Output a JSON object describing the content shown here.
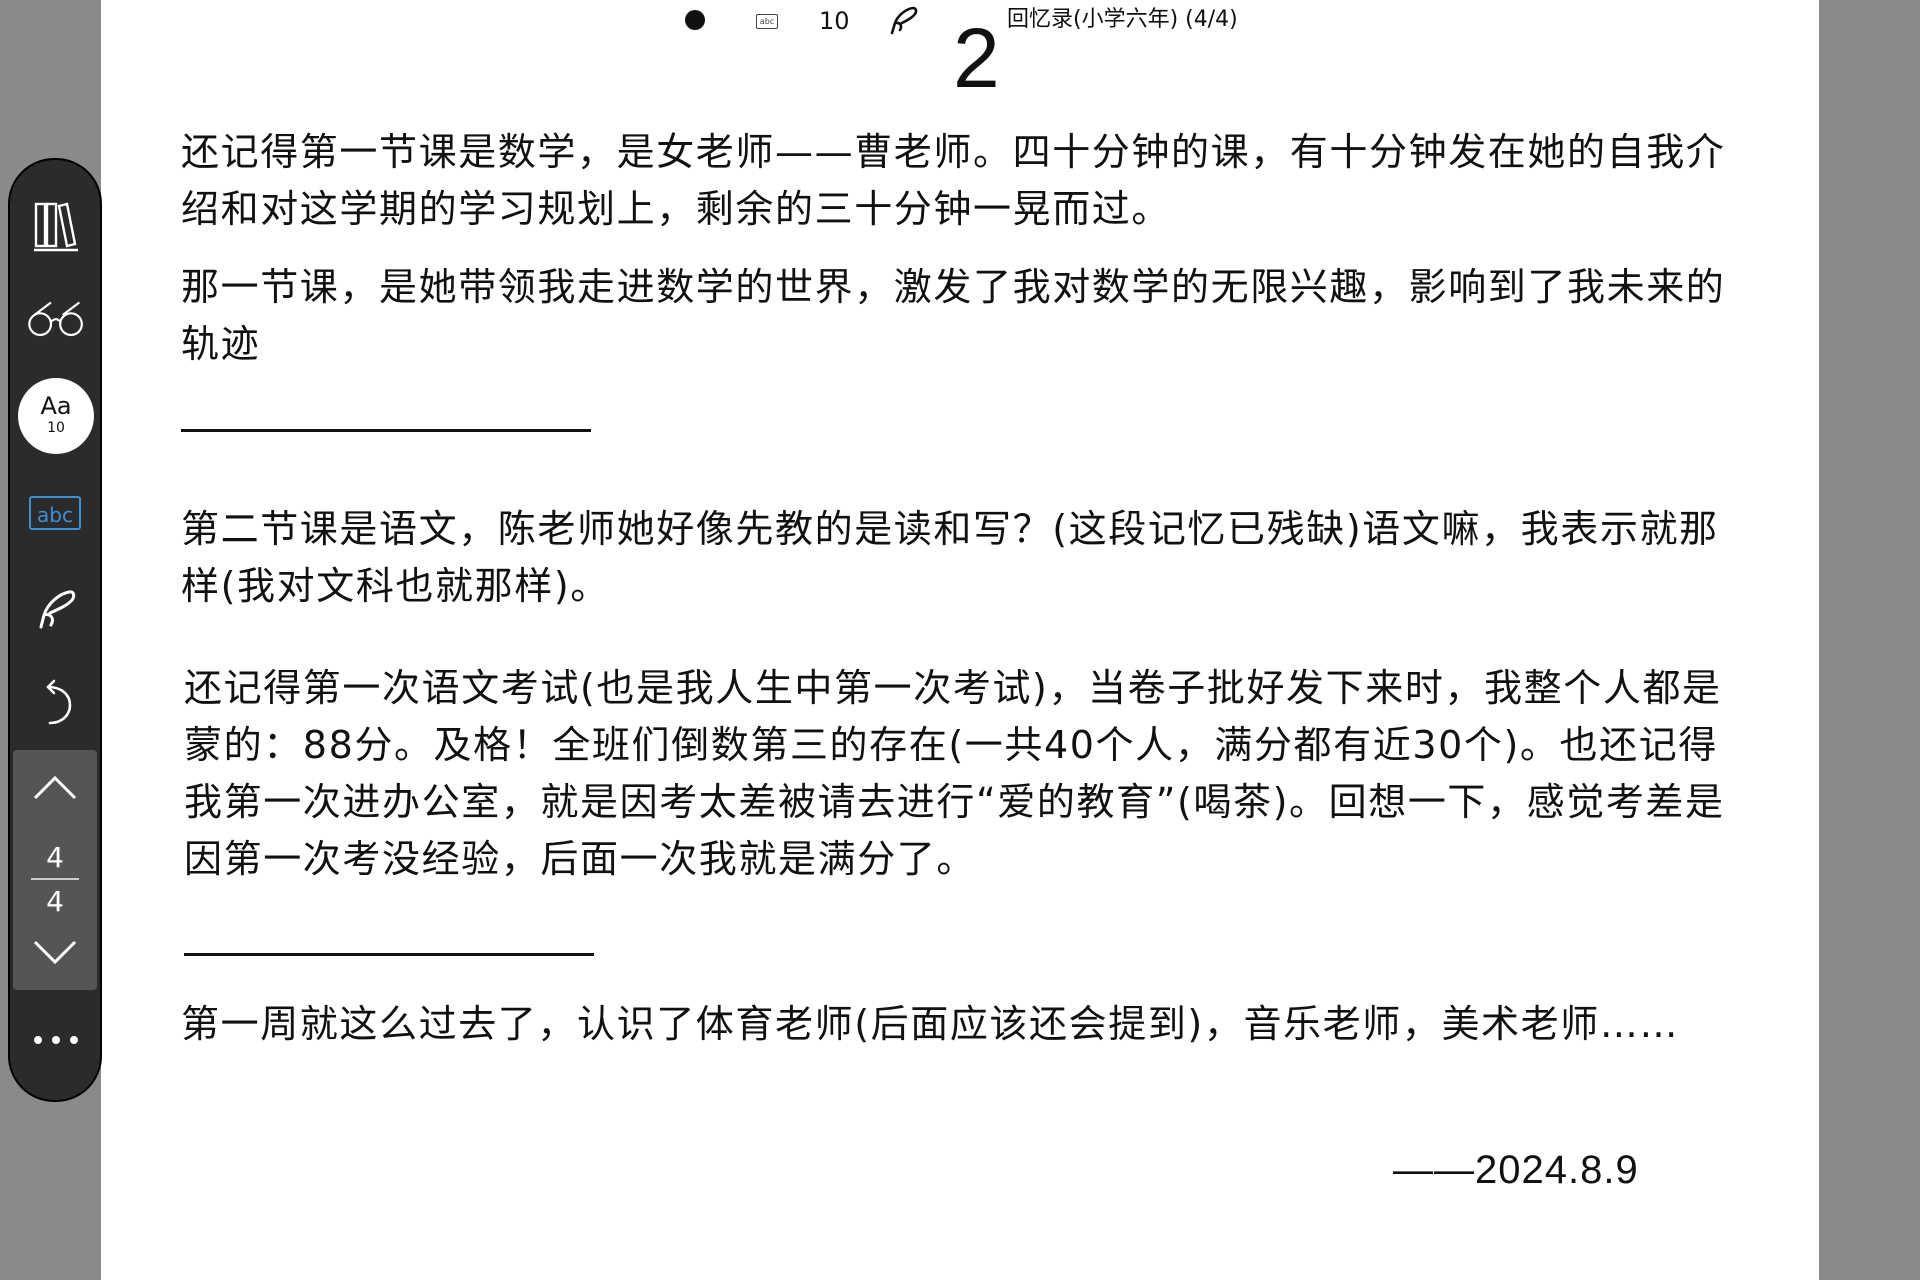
{
  "status_bar": {
    "font_size": "10",
    "book_title": "回忆录(小学六年) (4/4)"
  },
  "page_number": "2",
  "paragraphs": [
    [
      "还记得第一节课是数学，是女老师——曹老师。四十分钟的课，有十分钟发在她的自我介",
      "绍和对这学期的学习规划上，剩余的三十分钟一晃而过。"
    ],
    [
      "那一节课，是她带领我走进数学的世界，激发了我对数学的无限兴趣，影响到了我未来的",
      "轨迹"
    ],
    [
      "第二节课是语文，陈老师她好像先教的是读和写？(这段记忆已残缺)语文嘛，我表示就那",
      "样(我对文科也就那样)。"
    ],
    [
      "还记得第一次语文考试(也是我人生中第一次考试)，当卷子批好发下来时，我整个人都是",
      "蒙的：88分。及格！全班们倒数第三的存在(一共40个人，满分都有近30个)。也还记得",
      "我第一次进办公室，就是因考太差被请去进行“爱的教育”(喝茶)。回想一下，感觉考差是",
      "因第一次考没经验，后面一次我就是满分了。"
    ],
    [
      "第一周就这么过去了，认识了体育老师(后面应该还会提到)，音乐老师，美术老师……"
    ]
  ],
  "date_signature": "——2024.8.9",
  "toolbar": {
    "font_label": "Aa",
    "font_size": "10",
    "abc_label": "abc",
    "current_page": "4",
    "total_pages": "4"
  },
  "icons": [
    "bookshelf-icon",
    "glasses-icon",
    "font-size-icon",
    "abc-icon",
    "pen-icon",
    "undo-icon",
    "chevron-up-icon",
    "chevron-down-icon",
    "more-icon"
  ]
}
